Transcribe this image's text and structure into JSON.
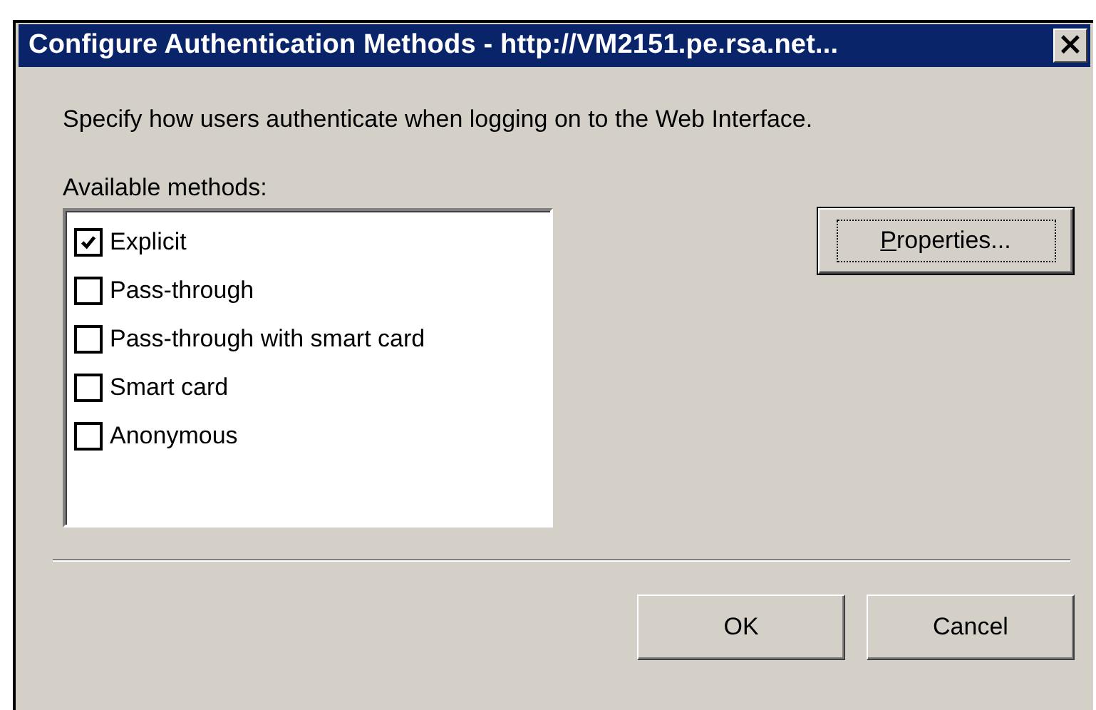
{
  "window": {
    "title": "Configure Authentication Methods - http://VM2151.pe.rsa.net...",
    "close": "×"
  },
  "description": "Specify how users authenticate when logging on to the Web Interface.",
  "methods_label": "Available methods:",
  "methods": [
    {
      "label": "Explicit",
      "checked": true
    },
    {
      "label": "Pass-through",
      "checked": false
    },
    {
      "label": "Pass-through with smart card",
      "checked": false
    },
    {
      "label": "Smart card",
      "checked": false
    },
    {
      "label": "Anonymous",
      "checked": false
    }
  ],
  "properties_button": {
    "label": "Properties...",
    "focused": true
  },
  "buttons": [
    {
      "label": "OK"
    },
    {
      "label": "Cancel"
    }
  ]
}
